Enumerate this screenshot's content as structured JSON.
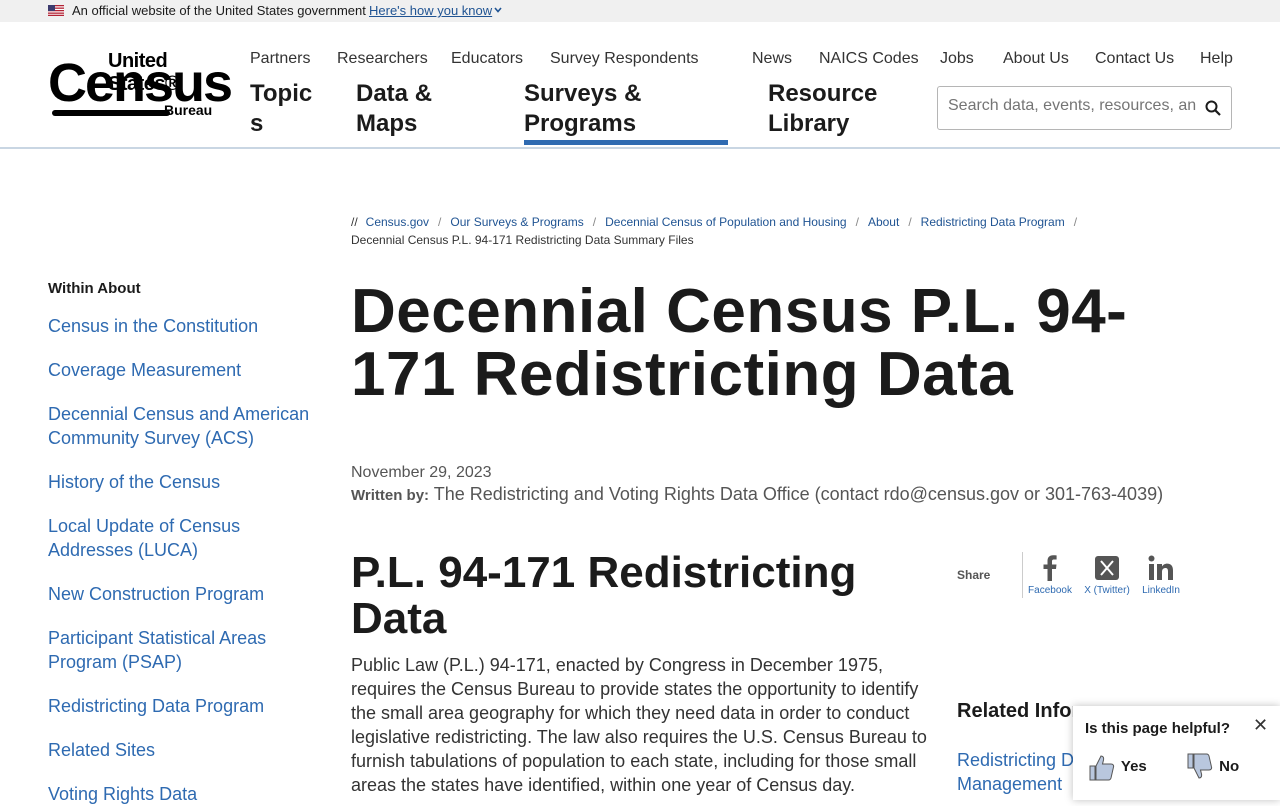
{
  "gov_banner": {
    "text": "An official website of the United States government",
    "link": "Here's how you know"
  },
  "logo": {
    "line1": "United States®",
    "line2": "Census",
    "line3": "Bureau"
  },
  "utility_nav": [
    "Partners",
    "Researchers",
    "Educators",
    "Survey Respondents",
    "News",
    "NAICS Codes",
    "Jobs",
    "About Us",
    "Contact Us",
    "Help"
  ],
  "main_nav": {
    "topics_line1": "Topic",
    "topics_line2": "s",
    "data_line1": "Data &",
    "data_line2": "Maps",
    "surveys_line1": "Surveys &",
    "surveys_line2": "Programs",
    "resource_line1": "Resource",
    "resource_line2": "Library"
  },
  "search": {
    "placeholder": "Search data, events, resources, an…"
  },
  "breadcrumb": {
    "prefix": "//",
    "items": [
      "Census.gov",
      "Our Surveys & Programs",
      "Decennial Census of Population and Housing",
      "About",
      "Redistricting Data Program"
    ],
    "current": "Decennial Census P.L. 94-171 Redistricting Data Summary Files"
  },
  "sidebar": {
    "heading": "Within About",
    "items": [
      "Census in the Constitution",
      "Coverage Measurement",
      "Decennial Census and American Community Survey (ACS)",
      "History of the Census",
      "Local Update of Census Addresses (LUCA)",
      "New Construction Program",
      "Participant Statistical Areas Program (PSAP)",
      "Redistricting Data Program",
      "Related Sites",
      "Voting Rights Data"
    ]
  },
  "page": {
    "title": "Decennial Census P.L. 94-171 Redistricting Data",
    "date": "November 29, 2023",
    "written_by_label": "Written by:",
    "written_by": "The Redistricting and Voting Rights Data Office (contact rdo@census.gov or 301-763-4039)",
    "section_title": "P.L. 94-171 Redistricting Data",
    "body": "Public Law (P.L.) 94-171, enacted by Congress in December 1975, requires the Census Bureau to provide states the opportunity to identify the small area geography for which they need data in order to conduct legislative redistricting. The law also requires the U.S. Census Bureau to furnish tabulations of population to each state, including for those small areas the states have identified, within one year of Census day."
  },
  "share": {
    "label": "Share",
    "facebook": "Facebook",
    "twitter": "X (Twitter)",
    "linkedin": "LinkedIn"
  },
  "related": {
    "title": "Related Infor",
    "link": "Redistricting D Management"
  },
  "feedback": {
    "question": "Is this page helpful?",
    "yes": "Yes",
    "no": "No"
  },
  "colors": {
    "link": "#2e6ab1",
    "nav_underline": "#2e6ab1",
    "banner_bg": "#f0f0f0"
  }
}
